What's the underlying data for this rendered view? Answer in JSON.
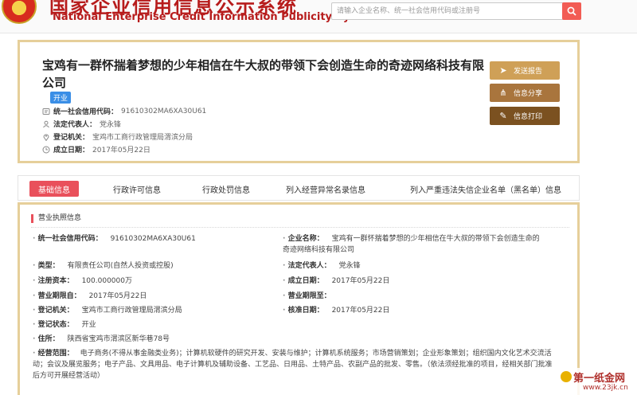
{
  "header": {
    "logo_cn": "国家企业信用信息公示系统",
    "logo_en": "National Enterprise Credit Information Publicity System",
    "search_placeholder": "请输入企业名称、统一社会信用代码或注册号"
  },
  "company": {
    "name": "宝鸡有一群怀揣着梦想的少年相信在牛大叔的带领下会创造生命的奇迹网络科技有限公司",
    "status": "开业",
    "rows": [
      {
        "label": "统一社会信用代码：",
        "value": "91610302MA6XA30U61"
      },
      {
        "label": "法定代表人：",
        "value": "党永锋"
      },
      {
        "label": "登记机关：",
        "value": "宝鸡市工商行政管理局渭滨分局"
      },
      {
        "label": "成立日期：",
        "value": "2017年05月22日"
      }
    ],
    "actions": [
      "发送报告",
      "信息分享",
      "信息打印"
    ]
  },
  "tabs": [
    "基础信息",
    "行政许可信息",
    "行政处罚信息",
    "列入经营异常名录信息",
    "列入严重违法失信企业名单（黑名单）信息"
  ],
  "license": {
    "section_title": "营业执照信息",
    "credit_code": {
      "label": "统一社会信用代码：",
      "value": "91610302MA6XA30U61"
    },
    "company_name": {
      "label": "企业名称：",
      "value": "宝鸡有一群怀揣着梦想的少年相信在牛大叔的带领下会创造生命的奇迹网络科技有限公司"
    },
    "type": {
      "label": "类型：",
      "value": "有限责任公司(自然人投资或控股)"
    },
    "legal_rep": {
      "label": "法定代表人：",
      "value": "党永锋"
    },
    "capital": {
      "label": "注册资本：",
      "value": "100.000000万"
    },
    "founded": {
      "label": "成立日期：",
      "value": "2017年05月22日"
    },
    "term_from": {
      "label": "营业期限自：",
      "value": "2017年05月22日"
    },
    "term_to": {
      "label": "营业期限至：",
      "value": ""
    },
    "authority": {
      "label": "登记机关：",
      "value": "宝鸡市工商行政管理局渭滨分局"
    },
    "approved": {
      "label": "核准日期：",
      "value": "2017年05月22日"
    },
    "reg_status": {
      "label": "登记状态：",
      "value": "开业"
    },
    "address": {
      "label": "住所：",
      "value": "陕西省宝鸡市渭滨区新华巷78号"
    },
    "scope": {
      "label": "经营范围：",
      "value": "电子商务(不得从事金融类业务)；计算机软硬件的研究开发、安装与维护；计算机系统服务；市场营销策划；企业形象策划；组织国内文化艺术交流活动；会议及展览服务；电子产品、文具用品、电子计算机及辅助设备、工艺品、日用品、土特产品、农副产品的批发、零售。（依法须经批准的项目，经相关部门批准后方可开展经营活动）"
    }
  },
  "watermark": {
    "name": "第一纸金网",
    "url": "www.23jk.cn"
  },
  "colors": {
    "brand_red": "#b71c1c",
    "active_tab": "#e9505b",
    "card_border": "#e6cf9a",
    "status_tag": "#3a8ee6"
  }
}
